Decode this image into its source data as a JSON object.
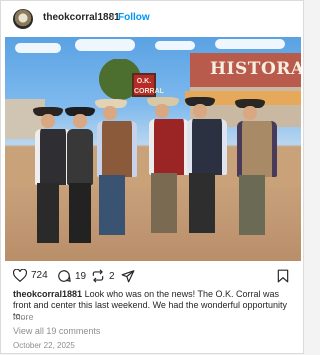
{
  "post": {
    "username": "theokcorral1881",
    "separator": "•",
    "follow_label": "Follow",
    "photo": {
      "building_sign": "HISTORAMA",
      "ok_sign": "O.K. CORRAL"
    },
    "actions": {
      "likes": "724",
      "comments": "19",
      "reposts": "2"
    },
    "caption": {
      "username": "theokcorral1881",
      "text": "Look who was on the news! The O.K. Corral was front and center this last weekend. We had the wonderful opportunity to..."
    },
    "more_label": "more",
    "view_comments_label": "View all 19 comments",
    "date": "October 22, 2025"
  }
}
